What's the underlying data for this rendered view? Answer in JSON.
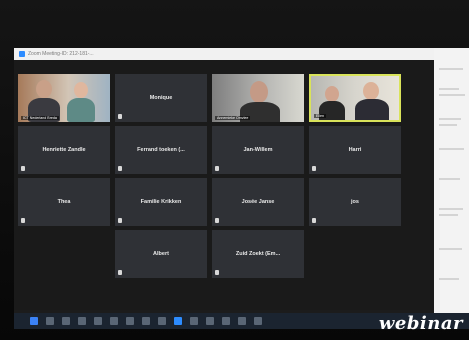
{
  "window": {
    "title": "Zoom Meeting-ID: 212-181-..."
  },
  "participants": [
    {
      "id": "p1",
      "name": "ICT Nederland Breda",
      "type": "video"
    },
    {
      "id": "p2",
      "name": "Monique",
      "type": "name"
    },
    {
      "id": "p3",
      "name": "Annemieke Omvlee",
      "type": "video"
    },
    {
      "id": "p4",
      "name": "Ellen",
      "type": "video",
      "speaking": true
    },
    {
      "id": "p5",
      "name": "Henriette Zandle",
      "type": "name"
    },
    {
      "id": "p6",
      "name": "Ferrand toeken (...",
      "type": "name"
    },
    {
      "id": "p7",
      "name": "Jan-Willem",
      "type": "name"
    },
    {
      "id": "p8",
      "name": "Harri",
      "type": "name"
    },
    {
      "id": "p9",
      "name": "Thea",
      "type": "name"
    },
    {
      "id": "p10",
      "name": "Familie Krikken",
      "type": "name"
    },
    {
      "id": "p11",
      "name": "Josée Janse",
      "type": "name"
    },
    {
      "id": "p12",
      "name": "jos",
      "type": "name"
    },
    {
      "id": "p13",
      "name": "Albert",
      "type": "name"
    },
    {
      "id": "p14",
      "name": "Zuid Zoekt (Em...",
      "type": "name"
    }
  ],
  "watermark": "webinar",
  "colors": {
    "tile_bg": "#2f3136",
    "speaker_border": "#d9e35a",
    "taskbar": "#1b2430"
  }
}
